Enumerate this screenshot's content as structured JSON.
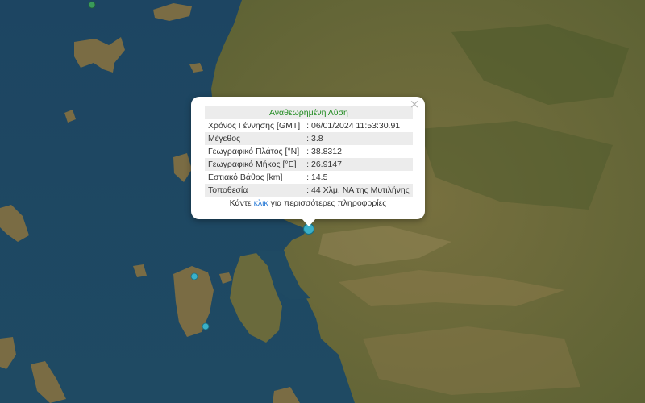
{
  "popup": {
    "title": "Αναθεωρημένη Λύση",
    "close_symbol": "×",
    "rows": [
      {
        "label": "Χρόνος Γέννησης [GMT]",
        "value": ": 06/01/2024 11:53:30.91"
      },
      {
        "label": "Μέγεθος",
        "value": ": 3.8"
      },
      {
        "label": "Γεωγραφικό Πλάτος [°N]",
        "value": ": 38.8312"
      },
      {
        "label": "Γεωγραφικό Μήκος [°E]",
        "value": ": 26.9147"
      },
      {
        "label": "Εστιακό Βάθος [km]",
        "value": ": 14.5"
      },
      {
        "label": "Τοποθεσία",
        "value": ": 44 Χλμ. ΝΑ της Μυτιλήνης"
      }
    ],
    "more_prefix": "Κάντε ",
    "more_link": "κλικ",
    "more_suffix": " για περισσότερες πληροφορίες"
  },
  "colors": {
    "sea": "#1e4460",
    "land": "#6b6a3a",
    "marker": "#3ab0c8",
    "old_event_marker": "#3a9a5a",
    "title_green": "#1e8a1e",
    "link_blue": "#2a7bd6"
  },
  "icons": [
    "close-icon",
    "earthquake-marker-icon"
  ]
}
